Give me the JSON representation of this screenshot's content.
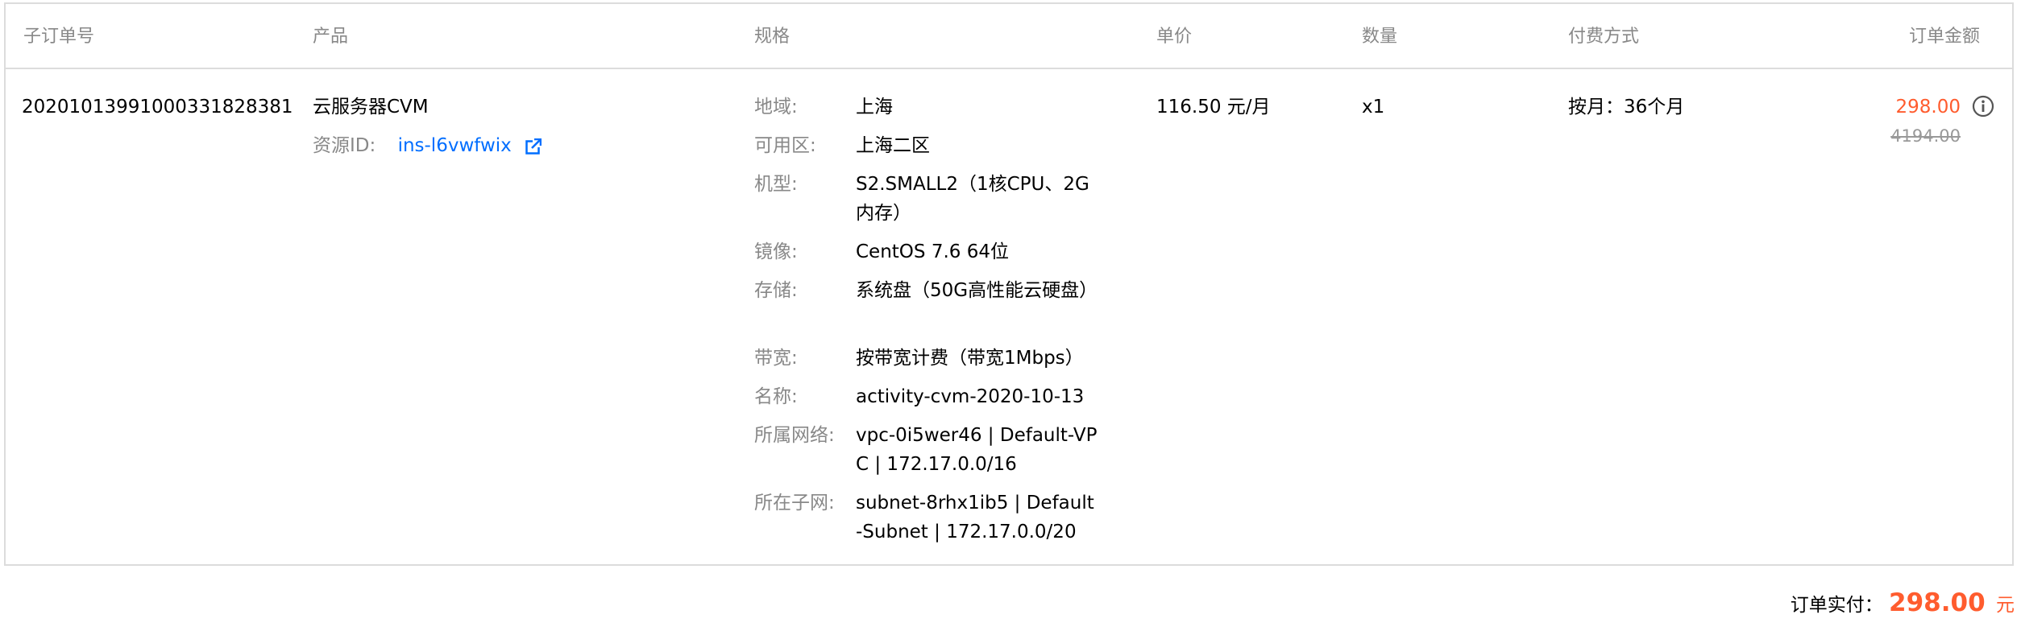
{
  "headers": {
    "sub_order_no": "子订单号",
    "product": "产品",
    "spec": "规格",
    "unit_price": "单价",
    "quantity": "数量",
    "payment_method": "付费方式",
    "order_amount": "订单金额"
  },
  "row": {
    "sub_order_no": "20201013991000331828381",
    "product_name": "云服务器CVM",
    "resource_id_label": "资源ID:",
    "resource_id": "ins-l6vwfwix",
    "unit_price": "116.50 元/月",
    "quantity": "x1",
    "payment_method": "按月：36个月",
    "amount_current": "298.00",
    "amount_original": "4194.00"
  },
  "spec": [
    {
      "label": "地域:",
      "value": "上海"
    },
    {
      "label": "可用区:",
      "value": "上海二区"
    },
    {
      "label": "机型:",
      "value": "S2.SMALL2（1核CPU、2G内存）"
    },
    {
      "label": "镜像:",
      "value": "CentOS 7.6 64位"
    },
    {
      "label": "存储:",
      "value": "系统盘（50G高性能云硬盘）"
    },
    {
      "label": "带宽:",
      "value": "按带宽计费（带宽1Mbps）"
    },
    {
      "label": "名称:",
      "value": "activity-cvm-2020-10-13"
    },
    {
      "label": "所属网络:",
      "value": "vpc-0i5wer46 | Default-VPC | 172.17.0.0/16"
    },
    {
      "label": "所在子网:",
      "value": "subnet-8rhx1ib5 | Default-Subnet | 172.17.0.0/20"
    }
  ],
  "footer": {
    "label": "订单实付：",
    "amount": "298.00",
    "unit": "元"
  },
  "icons": {
    "external_link": "external-link-icon",
    "info": "info-icon"
  },
  "colors": {
    "accent_price": "#ff5c2e",
    "link": "#006eff",
    "muted": "#888888",
    "border": "#dcdcdc"
  }
}
